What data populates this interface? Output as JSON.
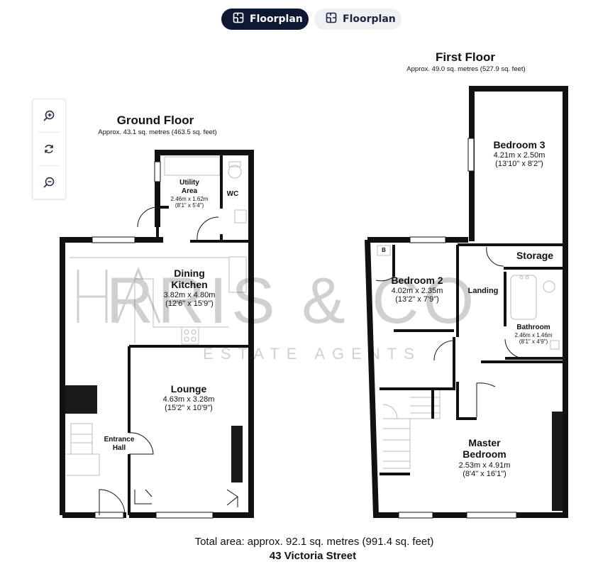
{
  "tabs": [
    {
      "label": "Floorplan",
      "icon": "floorplan-icon",
      "active": true
    },
    {
      "label": "Floorplan",
      "icon": "floorplan-icon",
      "active": false
    }
  ],
  "zoom_controls": [
    {
      "icon": "zoom-in-icon"
    },
    {
      "icon": "rotate-icon"
    },
    {
      "icon": "zoom-out-icon"
    }
  ],
  "watermark": {
    "brand": "HARRIS & CO",
    "tagline": "ESTATE AGENTS"
  },
  "ground_floor": {
    "title": "Ground Floor",
    "area": "Approx. 43.1 sq. metres (463.5 sq. feet)",
    "rooms": {
      "utility": {
        "name_line1": "Utility",
        "name_line2": "Area",
        "metric": "2.46m x 1.62m",
        "imperial": "(8'1\" x 5'4\")"
      },
      "wc": {
        "name": "WC"
      },
      "dining": {
        "name_line1": "Dining",
        "name_line2": "Kitchen",
        "metric": "3.82m x 4.80m",
        "imperial": "(12'6\" x 15'9\")"
      },
      "lounge": {
        "name": "Lounge",
        "metric": "4.63m x 3.28m",
        "imperial": "(15'2\" x 10'9\")"
      },
      "hall": {
        "name_line1": "Entrance",
        "name_line2": "Hall"
      }
    }
  },
  "first_floor": {
    "title": "First Floor",
    "area": "Approx. 49.0 sq. metres (527.9 sq. feet)",
    "rooms": {
      "bedroom3": {
        "name": "Bedroom 3",
        "metric": "4.21m x 2.50m",
        "imperial": "(13'10\" x 8'2\")"
      },
      "storage": {
        "name": "Storage"
      },
      "bedroom2": {
        "name": "Bedroom 2",
        "metric": "4.02m x 2.35m",
        "imperial": "(13'2\" x 7'9\")"
      },
      "boiler": {
        "name": "B"
      },
      "landing": {
        "name": "Landing"
      },
      "bathroom": {
        "name": "Bathroom",
        "metric": "2.46m x 1.46m",
        "imperial": "(8'1\" x 4'9\")"
      },
      "master": {
        "name_line1": "Master",
        "name_line2": "Bedroom",
        "metric": "2.53m x 4.91m",
        "imperial": "(8'4\" x 16'1\")"
      }
    }
  },
  "footer": {
    "total": "Total area: approx. 92.1 sq. metres (991.4 sq. feet)",
    "address": "43 Victoria Street"
  }
}
